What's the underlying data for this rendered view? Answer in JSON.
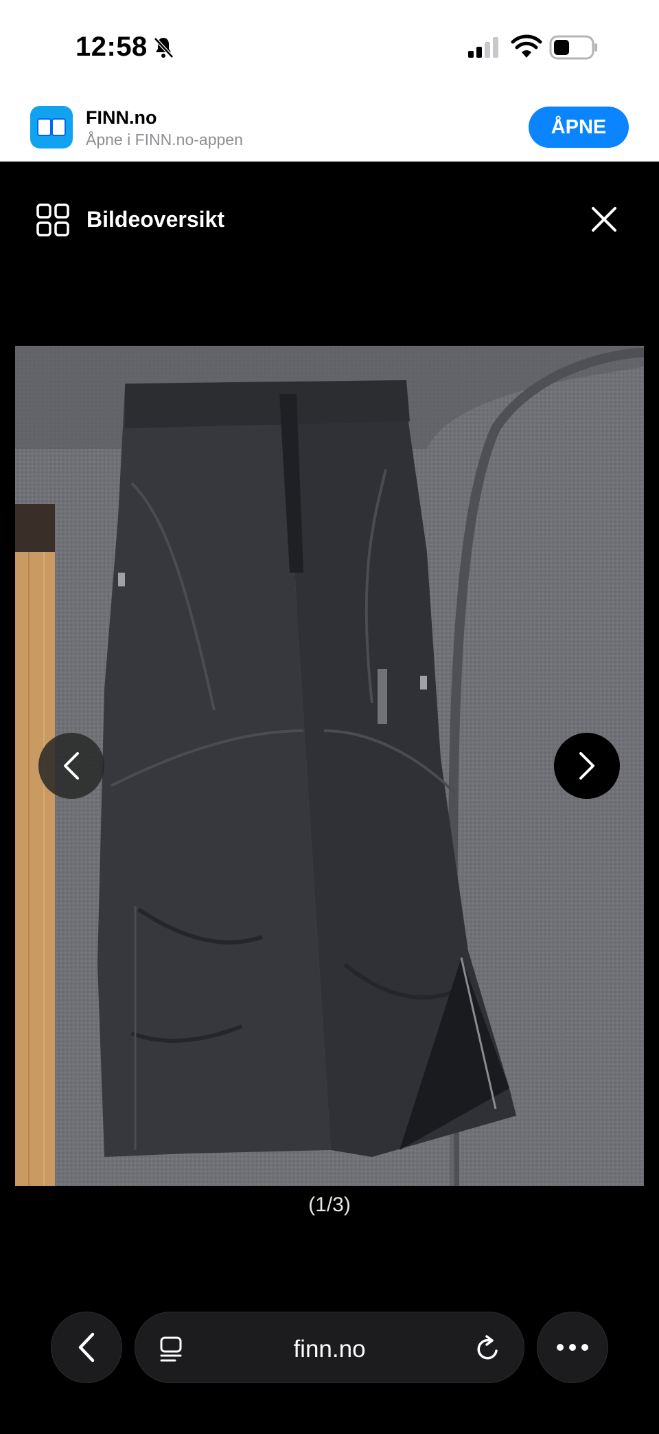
{
  "status_bar": {
    "time": "12:58",
    "icons": [
      "bell-slash-icon",
      "cellular-signal-icon",
      "wifi-icon",
      "battery-icon"
    ]
  },
  "app_banner": {
    "app_name": "FINN.no",
    "subtitle": "Åpne i FINN.no-appen",
    "open_label": "ÅPNE",
    "accent_color": "#0a84ff",
    "logo_color": "#12a3f0"
  },
  "viewer": {
    "overview_label": "Bildeoversikt",
    "image_counter": "(1/3)",
    "image_subject": "black-ski-pants-photo"
  },
  "browser": {
    "url": "finn.no",
    "icons": [
      "back-icon",
      "tabs-icon",
      "reload-icon",
      "more-icon"
    ]
  }
}
